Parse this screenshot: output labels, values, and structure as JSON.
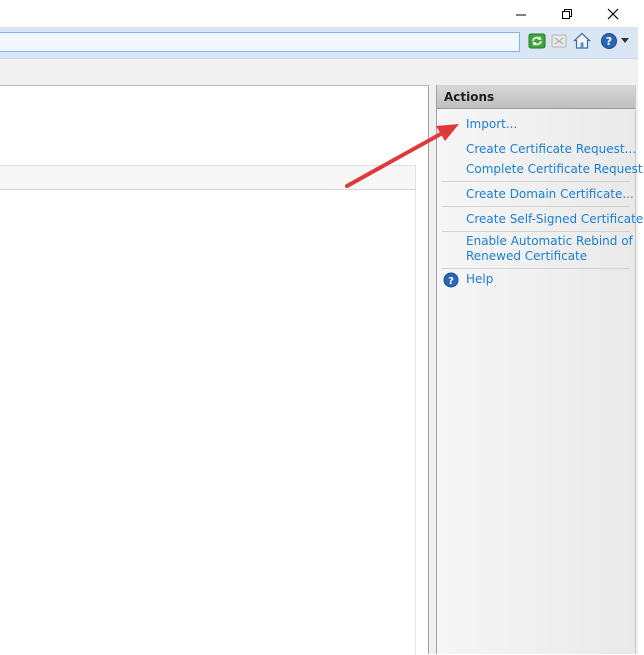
{
  "window": {
    "minimize_icon": "minimize-icon",
    "restore_icon": "restore-icon",
    "close_icon": "close-icon"
  },
  "toolbar": {
    "refresh_icon": "refresh-icon",
    "stop_icon": "stop-icon",
    "home_icon": "home-icon",
    "help_icon": "help-icon",
    "dropdown_icon": "chevron-down-icon"
  },
  "actions": {
    "title": "Actions",
    "items": [
      {
        "label": "Import..."
      },
      {
        "label": "Create Certificate Request..."
      },
      {
        "label": "Complete Certificate Request..."
      },
      {
        "label": "Create Domain Certificate..."
      },
      {
        "label": "Create Self-Signed Certificate..."
      },
      {
        "label": "Enable Automatic Rebind of"
      },
      {
        "label": "Renewed Certificate"
      },
      {
        "label": "Help"
      }
    ]
  },
  "colors": {
    "link": "#1a7fd1",
    "annotation_arrow": "#e0393a",
    "address_bar": "#dbe6f4"
  }
}
